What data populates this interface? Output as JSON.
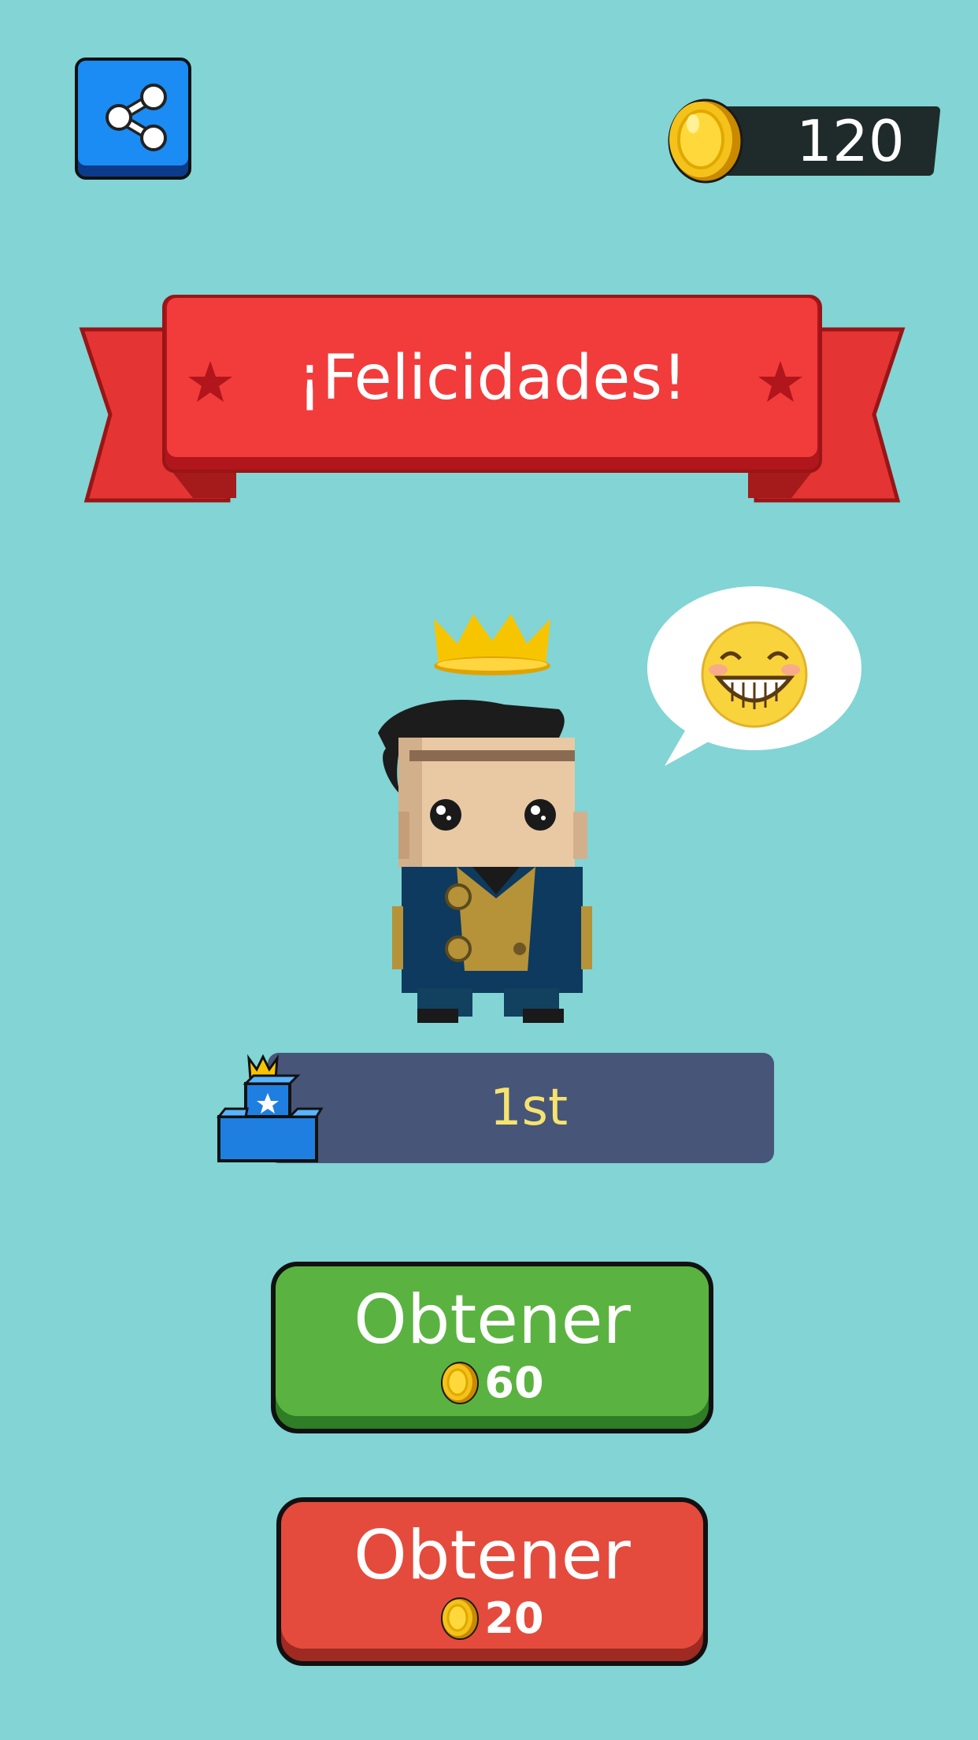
{
  "header": {
    "share_icon": "share-icon",
    "coins": "120",
    "coin_icon": "coin-icon"
  },
  "banner": {
    "title": "¡Felicidades!",
    "color": "#f23b3b",
    "star_icon": "star-icon"
  },
  "character": {
    "crown_icon": "crown-icon",
    "emote_icon": "grinning-face-icon"
  },
  "rank": {
    "label": "1st",
    "podium_icon": "podium-icon"
  },
  "buttons": [
    {
      "label": "Obtener",
      "price": "60",
      "color": "#5ab340"
    },
    {
      "label": "Obtener",
      "price": "20",
      "color": "#e44b3d"
    }
  ]
}
